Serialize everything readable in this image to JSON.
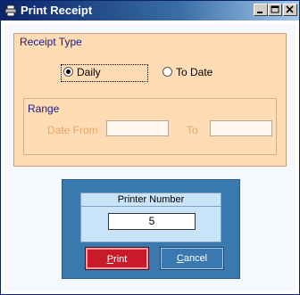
{
  "window": {
    "title": "Print Receipt",
    "controls": [
      "minimize",
      "maximize",
      "close"
    ]
  },
  "receipt_type": {
    "label": "Receipt Type",
    "options": [
      {
        "label": "Daily",
        "checked": true
      },
      {
        "label": "To Date",
        "checked": false
      }
    ]
  },
  "range": {
    "label": "Range",
    "date_from_label": "Date From",
    "date_from_value": "",
    "to_label": "To",
    "to_value": ""
  },
  "printer": {
    "label": "Printer Number",
    "value": "5"
  },
  "buttons": {
    "print_accel": "P",
    "print_rest": "rint",
    "cancel_accel": "C",
    "cancel_rest": "ancel"
  },
  "colors": {
    "titlebar": "#0a246a",
    "group_bg": "#ffdcb4",
    "panel_bg": "#3a79b0",
    "print_button": "#c81a2a"
  }
}
